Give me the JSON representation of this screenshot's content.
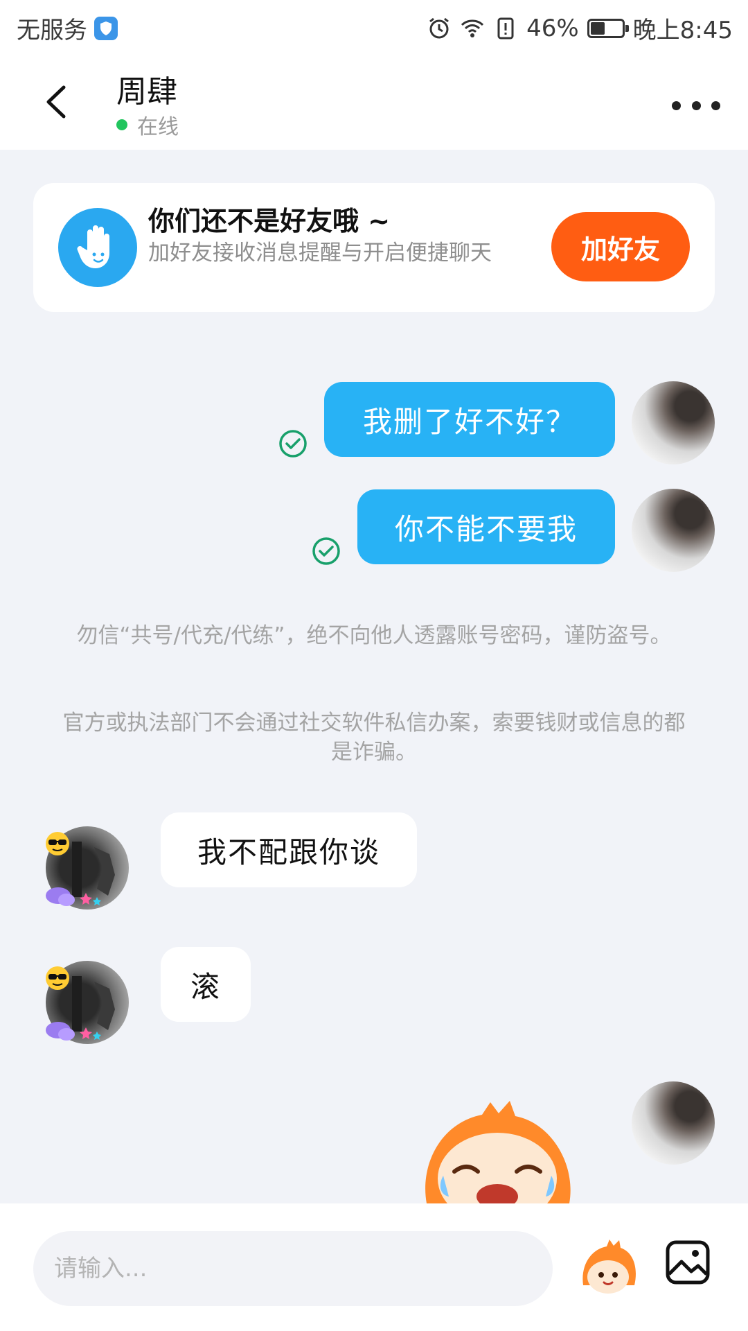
{
  "status_bar": {
    "carrier": "无服务",
    "battery": "46%",
    "battery_level": 0.46,
    "time": "晚上8:45"
  },
  "header": {
    "contact_name": "周肆",
    "status": "在线"
  },
  "friend_card": {
    "title": "你们还不是好友哦 ~",
    "description": "加好友接收消息提醒与开启便捷聊天",
    "button": "加好友"
  },
  "messages": [
    {
      "direction": "out",
      "text": "我删了好不好？"
    },
    {
      "direction": "out",
      "text": "你不能不要我"
    },
    {
      "direction": "in",
      "text": "我不配跟你谈"
    },
    {
      "direction": "in",
      "text": "滚"
    }
  ],
  "notices": [
    "勿信“共号/代充/代练”，绝不向他人透露账号密码，谨防盗号。",
    "官方或执法部门不会通过社交软件私信办案，索要钱财或信息的都是诈骗。"
  ],
  "input": {
    "placeholder": "请输入..."
  },
  "colors": {
    "accent": "#28b2f5",
    "add_friend": "#ff5d12",
    "online": "#22c55e"
  },
  "icons": [
    "back-icon",
    "more-icon",
    "hand-icon",
    "read-check-icon",
    "sticker-icon",
    "image-icon"
  ]
}
